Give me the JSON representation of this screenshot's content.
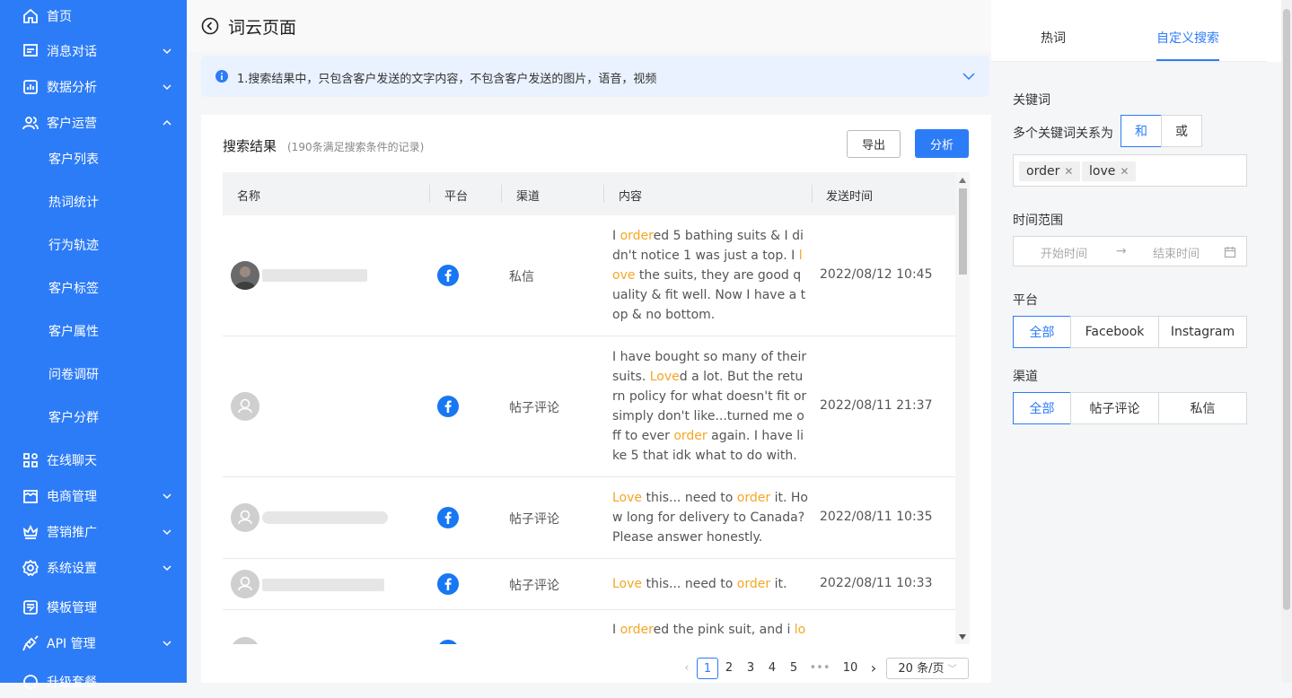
{
  "sidebar": {
    "items": [
      {
        "label": "首页",
        "icon": "home-icon"
      },
      {
        "label": "消息对话",
        "icon": "chat-icon",
        "chevron": "down"
      },
      {
        "label": "数据分析",
        "icon": "analytics-icon",
        "chevron": "down"
      },
      {
        "label": "客户运营",
        "icon": "users-icon",
        "chevron": "up"
      },
      {
        "label": "客户列表"
      },
      {
        "label": "热词统计"
      },
      {
        "label": "行为轨迹"
      },
      {
        "label": "客户标签"
      },
      {
        "label": "客户属性"
      },
      {
        "label": "问卷调研"
      },
      {
        "label": "客户分群"
      },
      {
        "label": "在线聊天",
        "icon": "apps-icon"
      },
      {
        "label": "电商管理",
        "icon": "shop-icon",
        "chevron": "down"
      },
      {
        "label": "营销推广",
        "icon": "crown-icon",
        "chevron": "down"
      },
      {
        "label": "系统设置",
        "icon": "settings-icon",
        "chevron": "down"
      },
      {
        "label": "模板管理",
        "icon": "template-icon"
      },
      {
        "label": "API 管理",
        "icon": "api-icon",
        "chevron": "down"
      },
      {
        "label": "升级套餐",
        "icon": "upgrade-icon"
      }
    ]
  },
  "header": {
    "title": "词云页面"
  },
  "notice": {
    "text": "1.搜索结果中，只包含客户发送的文字内容，不包含客户发送的图片，语音，视频"
  },
  "results": {
    "title": "搜索结果",
    "subtitle": "(190条满足搜索条件的记录)",
    "export_label": "导出",
    "analyze_label": "分析",
    "columns": [
      "名称",
      "平台",
      "渠道",
      "内容",
      "发送时间"
    ],
    "rows": [
      {
        "channel": "私信",
        "time": "2022/08/12 10:45",
        "content": [
          [
            "h",
            "I "
          ],
          [
            "hl",
            "order"
          ],
          [
            "t",
            "ed 5 bathing suits & I didn't notice 1 was just a top. I "
          ],
          [
            "hl",
            "love"
          ],
          [
            "t",
            " the suits, they are good quality & fit well. Now I have a top & no bottom."
          ]
        ]
      },
      {
        "channel": "帖子评论",
        "time": "2022/08/11 21:37",
        "content": [
          [
            "t",
            "I have bought so many of their suits. "
          ],
          [
            "hl",
            "Love"
          ],
          [
            "t",
            "d a lot. But the return policy for what doesn't fit or simply don't like...turned me off to ever "
          ],
          [
            "hl",
            "order"
          ],
          [
            "t",
            " again. I have like 5 that idk what to do with."
          ]
        ]
      },
      {
        "channel": "帖子评论",
        "time": "2022/08/11 10:35",
        "content": [
          [
            "hl",
            "Love"
          ],
          [
            "t",
            " this... need to "
          ],
          [
            "hl",
            "order"
          ],
          [
            "t",
            " it. How long for delivery to Canada? Please answer honestly."
          ]
        ]
      },
      {
        "channel": "帖子评论",
        "time": "2022/08/11 10:33",
        "content": [
          [
            "hl",
            "Love"
          ],
          [
            "t",
            " this... need to "
          ],
          [
            "hl",
            "order"
          ],
          [
            "t",
            " it."
          ]
        ]
      },
      {
        "channel": "",
        "time": "",
        "content": [
          [
            "t",
            "I "
          ],
          [
            "hl",
            "order"
          ],
          [
            "t",
            "ed the pink suit, and i "
          ],
          [
            "hl",
            "lov"
          ]
        ]
      }
    ]
  },
  "pagination": {
    "pages": [
      "1",
      "2",
      "3",
      "4",
      "5",
      "•••",
      "10"
    ],
    "current": "1",
    "page_size": "20 条/页"
  },
  "right_panel": {
    "tabs": [
      "热词",
      "自定义搜索"
    ],
    "active_tab": "自定义搜索",
    "keyword_label": "关键词",
    "relation_label": "多个关键词关系为",
    "relation_options": [
      "和",
      "或"
    ],
    "relation_selected": "和",
    "keywords": [
      "order",
      "love"
    ],
    "time_label": "时间范围",
    "start_placeholder": "开始时间",
    "arrow": "→",
    "end_placeholder": "结束时间",
    "platform_label": "平台",
    "platform_options": [
      "全部",
      "Facebook",
      "Instagram"
    ],
    "channel_label": "渠道",
    "channel_options": [
      "全部",
      "帖子评论",
      "私信"
    ]
  },
  "colors": {
    "accent": "#2d7cf7",
    "highlight": "#f5a623",
    "facebook": "#1877f2"
  }
}
